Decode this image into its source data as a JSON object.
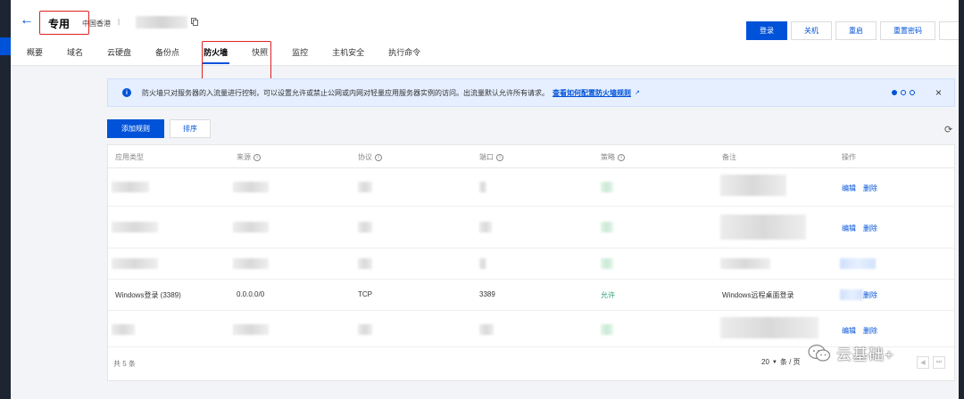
{
  "header": {
    "title": "专用",
    "region": "中国香港",
    "separator": "|",
    "buttons": [
      "登录",
      "关机",
      "重启",
      "重置密码"
    ]
  },
  "tabs": [
    "概要",
    "域名",
    "云硬盘",
    "备份点",
    "防火墙",
    "快照",
    "监控",
    "主机安全",
    "执行命令"
  ],
  "active_tab": "防火墙",
  "notice": {
    "text": "防火墙只对服务器的入流量进行控制，可以设置允许或禁止公网或内网对轻量应用服务器实例的访问。出流量默认允许所有请求。",
    "link": "查看如何配置防火墙规则",
    "icon": "info-icon"
  },
  "toolbar": {
    "add_rule": "添加规则",
    "sort": "排序"
  },
  "table": {
    "headers": [
      "应用类型",
      "来源",
      "协议",
      "端口",
      "策略",
      "备注",
      "操作"
    ],
    "action_edit": "编辑",
    "action_delete": "删除",
    "visible_row": {
      "app_type": "Windows登录 (3389)",
      "source": "0.0.0.0/0",
      "protocol": "TCP",
      "port": "3389",
      "policy": "允许",
      "remark": "Windows远程桌面登录"
    },
    "total": "共 5 条",
    "page_size": "20",
    "page_size_suffix": "条 / 页"
  },
  "watermark": "云基础+",
  "colors": {
    "primary": "#0052d9",
    "highlight_box": "#e02020",
    "allow": "#2ba471"
  }
}
